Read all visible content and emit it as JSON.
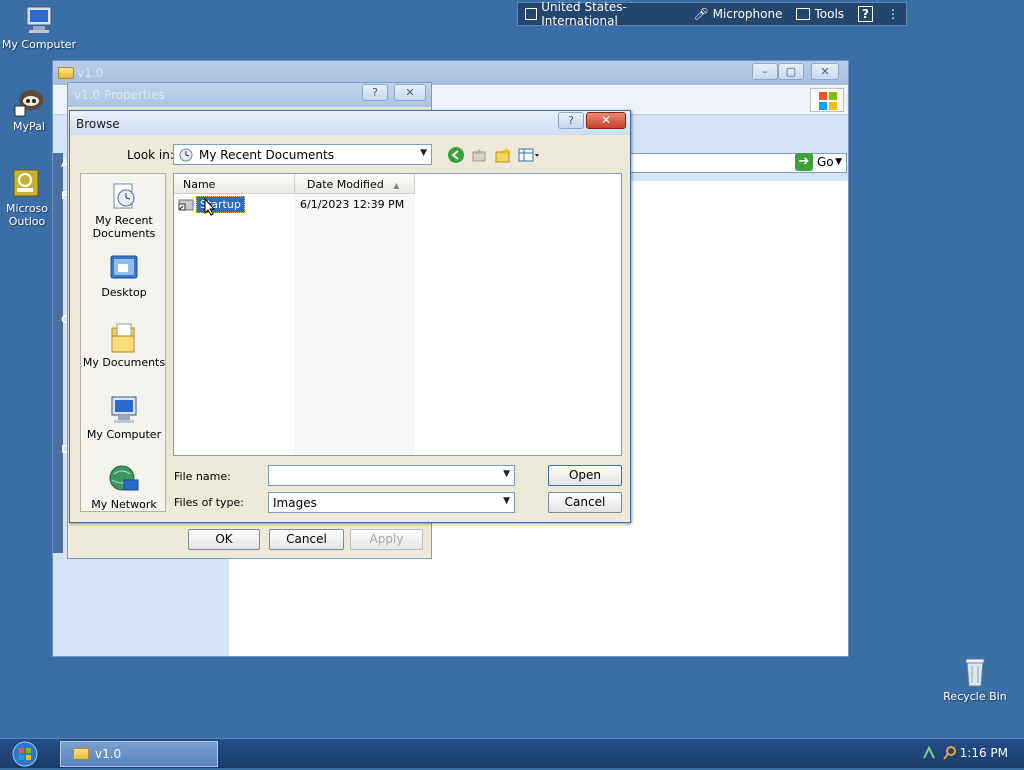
{
  "langbar": {
    "language": "United States-International",
    "microphone": "Microphone",
    "tools": "Tools",
    "help": "?"
  },
  "desktop": {
    "my_computer": "My Computer",
    "mypal": "MyPal",
    "outlook_line1": "Microso",
    "outlook_line2": "Outloo",
    "recycle_bin": "Recycle Bin"
  },
  "back_window": {
    "title": "v1.0",
    "go_label": "Go",
    "side_letters": [
      "A",
      "F",
      "C",
      "D"
    ]
  },
  "properties_dialog": {
    "title": "v1.0 Properties",
    "ok": "OK",
    "cancel": "Cancel",
    "apply": "Apply"
  },
  "browse_dialog": {
    "title": "Browse",
    "look_in_label": "Look in:",
    "look_in_value": "My Recent Documents",
    "places": [
      "My Recent Documents",
      "Desktop",
      "My Documents",
      "My Computer",
      "My Network"
    ],
    "columns": {
      "name": "Name",
      "date_modified": "Date Modified"
    },
    "files": [
      {
        "name": "Startup",
        "date_modified": "6/1/2023 12:39 PM"
      }
    ],
    "file_name_label": "File name:",
    "file_name_value": "",
    "files_of_type_label": "Files of type:",
    "files_of_type_value": "Images",
    "open": "Open",
    "cancel": "Cancel"
  },
  "taskbar": {
    "task_label": "v1.0",
    "clock": "1:16 PM"
  }
}
